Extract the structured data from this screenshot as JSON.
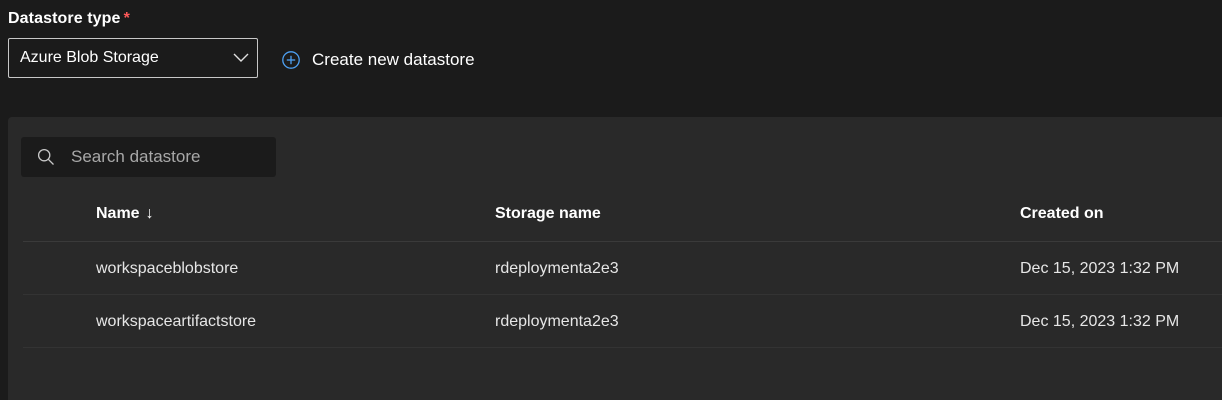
{
  "datastore_type": {
    "label": "Datastore type",
    "required_marker": "*",
    "selected_value": "Azure Blob Storage"
  },
  "create_link": {
    "label": "Create new datastore"
  },
  "search": {
    "placeholder": "Search datastore",
    "value": ""
  },
  "table": {
    "columns": [
      {
        "label": "Name",
        "sort_indicator": "↓"
      },
      {
        "label": "Storage name"
      },
      {
        "label": "Created on"
      }
    ],
    "rows": [
      {
        "name": "workspaceblobstore",
        "storage_name": "rdeploymenta2e3",
        "created_on": "Dec 15, 2023 1:32 PM"
      },
      {
        "name": "workspaceartifactstore",
        "storage_name": "rdeploymenta2e3",
        "created_on": "Dec 15, 2023 1:32 PM"
      }
    ]
  },
  "colors": {
    "page_background": "#1b1b1b",
    "panel_background": "#292929",
    "accent_blue": "#4ea1f3",
    "required_red": "#ff5a5a"
  },
  "icons": {
    "dropdown": "chevron-down-icon",
    "create": "add-circle-icon",
    "search": "search-icon"
  }
}
